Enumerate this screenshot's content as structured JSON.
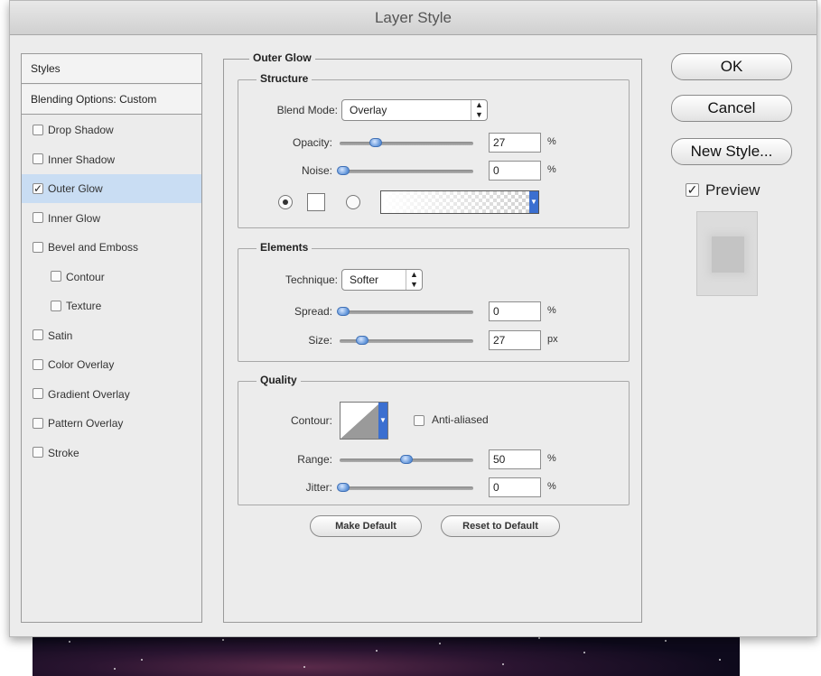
{
  "window": {
    "title": "Layer Style"
  },
  "styles_panel": {
    "header": "Styles",
    "blending_options": "Blending Options: Custom",
    "items": [
      {
        "label": "Drop Shadow",
        "checked": false,
        "indent": false,
        "selected": false
      },
      {
        "label": "Inner Shadow",
        "checked": false,
        "indent": false,
        "selected": false
      },
      {
        "label": "Outer Glow",
        "checked": true,
        "indent": false,
        "selected": true
      },
      {
        "label": "Inner Glow",
        "checked": false,
        "indent": false,
        "selected": false
      },
      {
        "label": "Bevel and Emboss",
        "checked": false,
        "indent": false,
        "selected": false
      },
      {
        "label": "Contour",
        "checked": false,
        "indent": true,
        "selected": false
      },
      {
        "label": "Texture",
        "checked": false,
        "indent": true,
        "selected": false
      },
      {
        "label": "Satin",
        "checked": false,
        "indent": false,
        "selected": false
      },
      {
        "label": "Color Overlay",
        "checked": false,
        "indent": false,
        "selected": false
      },
      {
        "label": "Gradient Overlay",
        "checked": false,
        "indent": false,
        "selected": false
      },
      {
        "label": "Pattern Overlay",
        "checked": false,
        "indent": false,
        "selected": false
      },
      {
        "label": "Stroke",
        "checked": false,
        "indent": false,
        "selected": false
      }
    ]
  },
  "outer_glow": {
    "title": "Outer Glow",
    "structure": {
      "title": "Structure",
      "blend_mode_label": "Blend Mode:",
      "blend_mode_value": "Overlay",
      "opacity_label": "Opacity:",
      "opacity_value": "27",
      "opacity_unit": "%",
      "noise_label": "Noise:",
      "noise_value": "0",
      "noise_unit": "%"
    },
    "elements": {
      "title": "Elements",
      "technique_label": "Technique:",
      "technique_value": "Softer",
      "spread_label": "Spread:",
      "spread_value": "0",
      "spread_unit": "%",
      "size_label": "Size:",
      "size_value": "27",
      "size_unit": "px"
    },
    "quality": {
      "title": "Quality",
      "contour_label": "Contour:",
      "anti_aliased_label": "Anti-aliased",
      "range_label": "Range:",
      "range_value": "50",
      "range_unit": "%",
      "jitter_label": "Jitter:",
      "jitter_value": "0",
      "jitter_unit": "%"
    },
    "make_default": "Make Default",
    "reset_default": "Reset to Default"
  },
  "actions": {
    "ok": "OK",
    "cancel": "Cancel",
    "new_style": "New Style...",
    "preview": "Preview"
  }
}
